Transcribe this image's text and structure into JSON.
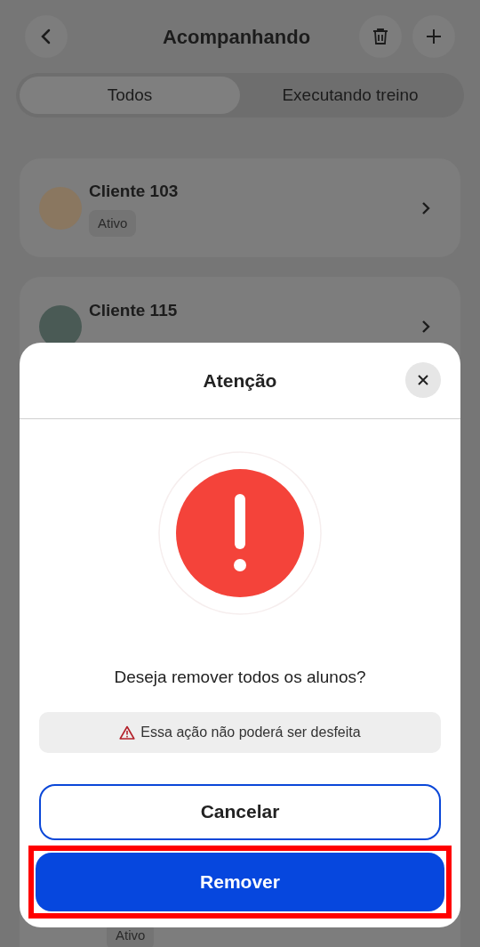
{
  "header": {
    "title": "Acompanhando"
  },
  "tabs": [
    {
      "label": "Todos",
      "selected": true
    },
    {
      "label": "Executando treino",
      "selected": false
    }
  ],
  "clients": [
    {
      "name": "Cliente 103",
      "status": "Ativo"
    },
    {
      "name": "Cliente 115"
    }
  ],
  "partial_client": {
    "status": "Ativo"
  },
  "dialog": {
    "title": "Atenção",
    "question": "Deseja remover todos os alunos?",
    "warning": "Essa ação não poderá ser desfeita",
    "buttons": [
      {
        "label": "Cancelar",
        "kind": "secondary",
        "highlighted": false
      },
      {
        "label": "Remover",
        "kind": "primary",
        "highlighted": true
      }
    ]
  }
}
